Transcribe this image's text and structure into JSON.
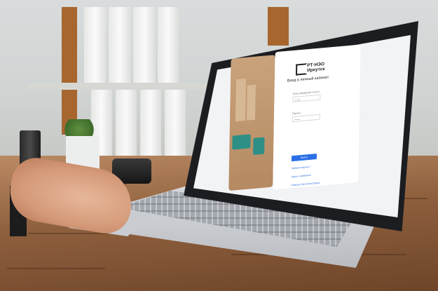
{
  "login_page": {
    "brand_top": "РТ-НЭО",
    "brand_bottom": "Иркутск",
    "title": "Вход в личный кабинет",
    "username_label": "Логин (Видимый логин)",
    "username_value": "9 cost",
    "password_label": "Пароль",
    "password_value": "••••••••",
    "login_button": "Войти",
    "links": [
      "Забыли пароль?",
      "Здесь в кабинете",
      "Помощь без регистрации"
    ]
  },
  "colors": {
    "accent": "#2b6fe6",
    "illustration": "#c9a27b",
    "truck": "#2e8f86"
  },
  "icons": [
    "rt-neo-logo-icon",
    "recycle-icon"
  ]
}
